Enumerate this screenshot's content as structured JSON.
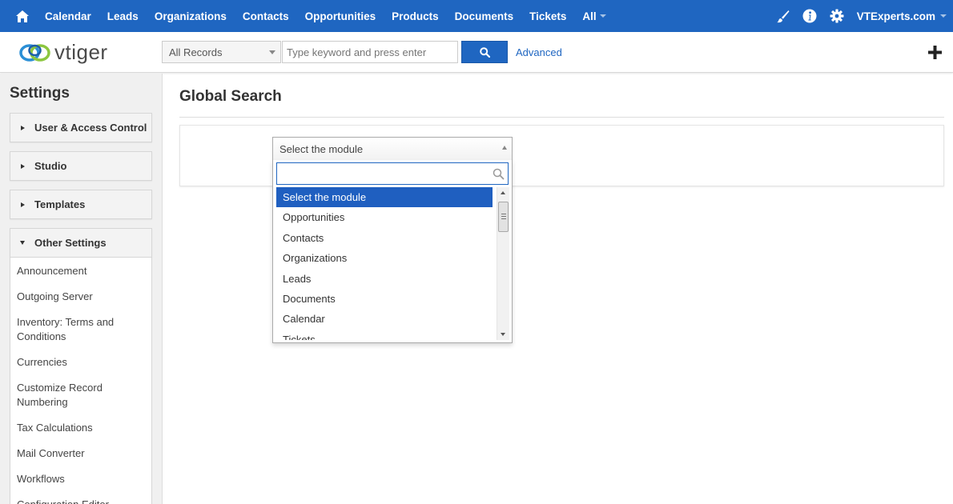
{
  "topnav": {
    "items": [
      "Calendar",
      "Leads",
      "Organizations",
      "Contacts",
      "Opportunities",
      "Products",
      "Documents",
      "Tickets"
    ],
    "all_label": "All",
    "user_label": "VTExperts.com"
  },
  "subbar": {
    "logo_text": "vtiger",
    "scope_value": "All Records",
    "search_placeholder": "Type keyword and press enter",
    "advanced_label": "Advanced"
  },
  "sidebar": {
    "title": "Settings",
    "groups": [
      "User & Access Control",
      "Studio",
      "Templates",
      "Other Settings"
    ],
    "items": [
      "Announcement",
      "Outgoing Server",
      "Inventory: Terms and Conditions",
      "Currencies",
      "Customize Record Numbering",
      "Tax Calculations",
      "Mail Converter",
      "Workflows",
      "Configuration Editor"
    ]
  },
  "main": {
    "title": "Global Search",
    "module_select_value": "Select the module",
    "options": [
      "Select the module",
      "Opportunities",
      "Contacts",
      "Organizations",
      "Leads",
      "Documents",
      "Calendar",
      "Tickets"
    ]
  },
  "colors": {
    "brand_blue": "#1f66c1",
    "selected_option": "#1f5fc0"
  },
  "icons": [
    "home-icon",
    "paintbrush-icon",
    "info-icon",
    "gear-icon",
    "search-icon",
    "plus-icon"
  ]
}
